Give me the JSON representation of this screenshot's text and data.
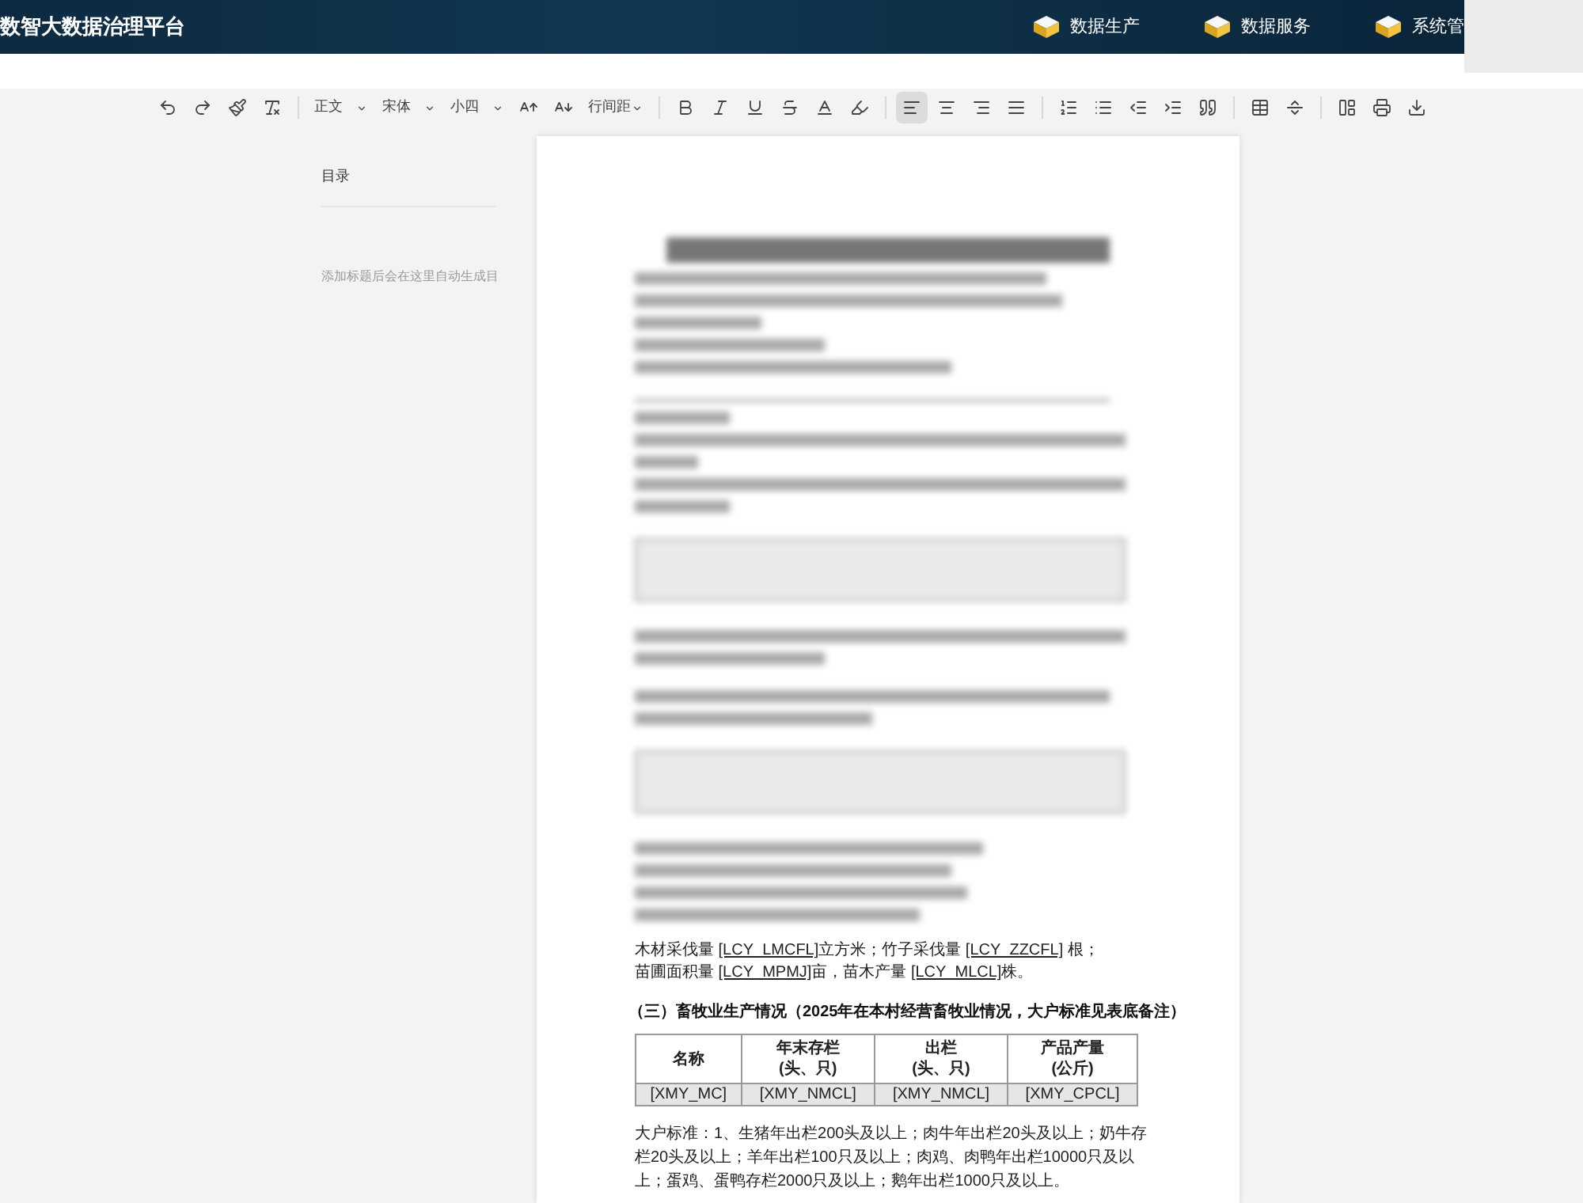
{
  "header": {
    "title": "数智大数据治理平台",
    "nav": [
      {
        "label": "数据生产"
      },
      {
        "label": "数据服务"
      },
      {
        "label": "系统管"
      }
    ]
  },
  "toolbar": {
    "dropdowns": [
      {
        "label": "正文"
      },
      {
        "label": "宋体"
      },
      {
        "label": "小四"
      }
    ],
    "line_spacing": {
      "label": "行间距"
    },
    "align": [
      {
        "selected": true
      },
      {
        "selected": false
      },
      {
        "selected": false
      },
      {
        "selected": false
      }
    ]
  },
  "sidebar": {
    "title": "目录",
    "hint": "添加标题后会在这里自动生成目"
  },
  "document": {
    "paragraphs": [
      [
        {
          "kind": "plain",
          "text": "木材采伐量 "
        },
        {
          "kind": "field",
          "text": "[LCY_LMCFL]"
        },
        {
          "kind": "plain",
          "text": "立方米；竹子采伐量 "
        },
        {
          "kind": "field",
          "text": "[LCY_ZZCFL]"
        },
        {
          "kind": "plain",
          "text": " 根；"
        }
      ],
      [
        {
          "kind": "plain",
          "text": "苗圃面积量 "
        },
        {
          "kind": "field",
          "text": "[LCY_MPMJ]"
        },
        {
          "kind": "plain",
          "text": "亩，苗木产量 "
        },
        {
          "kind": "field",
          "text": "[LCY_MLCL]"
        },
        {
          "kind": "plain",
          "text": "株。"
        }
      ]
    ],
    "heading": "（三）畜牧业生产情况（2025年在本村经营畜牧业情况，大户标准见表底备注）",
    "table": {
      "columns": [
        "名称",
        "年末存栏\n(头、只)",
        "出栏\n(头、只)",
        "产品产量\n(公斤)"
      ],
      "rows": [
        [
          "[XMY_MC]",
          "[XMY_NMCL]",
          "[XMY_NMCL]",
          "[XMY_CPCL]"
        ]
      ]
    },
    "note": "大户标准：1、生猪年出栏200头及以上；肉牛年出栏20头及以上；奶牛存栏20头及以上；羊年出栏100只及以上；肉鸡、肉鸭年出栏10000只及以上；蛋鸡、蛋鸭存栏2000只及以上；鹅年出栏1000只及以上。"
  }
}
